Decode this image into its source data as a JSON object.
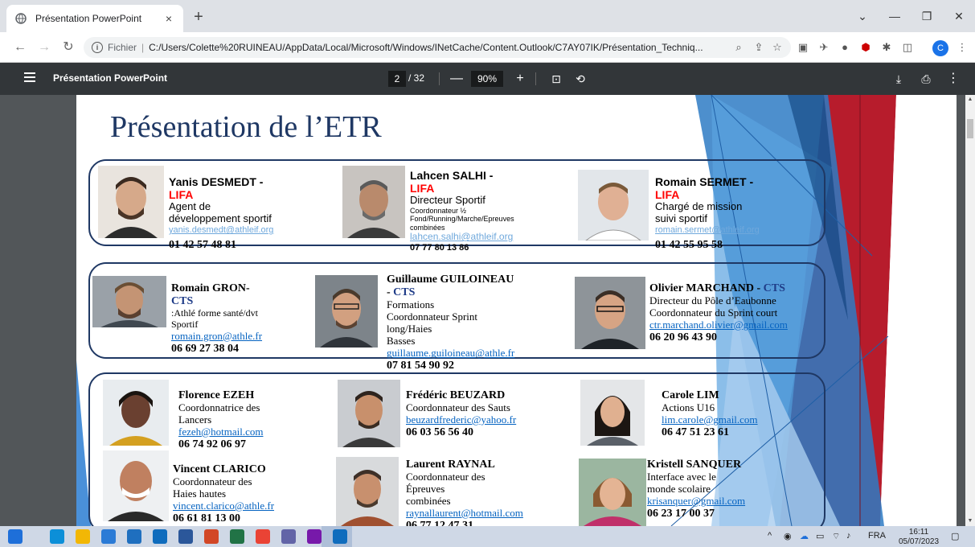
{
  "browser": {
    "tab_title": "Présentation PowerPoint",
    "tab_close": "×",
    "new_tab": "+",
    "scheme_label": "Fichier",
    "url": "C:/Users/Colette%20RUINEAU/AppData/Local/Microsoft/Windows/INetCache/Content.Outlook/C7AY07IK/Présentation_Techniq...",
    "profile_initial": "C"
  },
  "pdf_toolbar": {
    "title": "Présentation PowerPoint",
    "current_page": "2",
    "total_pages": "/ 32",
    "zoom": "90%"
  },
  "slide": {
    "title": "Présentation de l’ETR",
    "lifa_group": [
      {
        "name": "Yanis DESMEDT",
        "sep": " - ",
        "org": "LIFA",
        "role": "Agent de développement sportif",
        "email": "yanis.desmedt@athleif.org",
        "phone": "01 42 57 48 81"
      },
      {
        "name": "Lahcen SALHI",
        "sep": " - ",
        "org": "LIFA",
        "role": "Directeur Sportif",
        "role_line2": "Coordonnateur ½",
        "role_line3": "Fond/Running/Marche/Epreuves combinées",
        "email": "lahcen.salhi@athleif.org",
        "phone": "07 77 80 13 86"
      },
      {
        "name": "Romain SERMET",
        "sep": " - ",
        "org": "LIFA",
        "role": "Chargé de mission suivi sportif",
        "email": "romain.sermet@athleif.org",
        "phone": "01 42 55 95 58"
      }
    ],
    "cts_group": [
      {
        "name": "Romain GRON",
        "sep": "- ",
        "org": "CTS",
        "role": ":Athlé forme santé/dvt Sportif",
        "email": "romain.gron@athle.fr",
        "phone": "06 69 27 38 04"
      },
      {
        "name": "Guillaume GUILOINEAU",
        "sep": " - ",
        "org": "CTS",
        "role": "Formations",
        "role_line2": "Coordonnateur Sprint long/Haies",
        "role_line3": "Basses",
        "email": "guillaume.guiloineau@athle.fr",
        "phone": "07 81 54 90 92"
      },
      {
        "name": "Olivier MARCHAND",
        "sep": " - ",
        "org": "CTS",
        "role": "Directeur du Pôle d’Eaubonne",
        "role_line2": "Coordonnateur du Sprint court",
        "email": "ctr.marchand.olivier@gmail.com",
        "phone": "06 20 96 43 90"
      }
    ],
    "coord_group": [
      {
        "name": "Florence EZEH",
        "role": "Coordonnatrice des Lancers",
        "email": "fezeh@hotmail.com",
        "phone": "06 74 92 06 97"
      },
      {
        "name": "Frédéric BEUZARD",
        "role": "Coordonnateur des Sauts",
        "email": "beuzardfrederic@yahoo.fr",
        "phone": "06 03 56 56 40"
      },
      {
        "name": "Carole LIM",
        "role": "Actions U16",
        "email": "lim.carole@gmail.com",
        "phone": "06 47 51 23 61"
      },
      {
        "name": "Vincent CLARICO",
        "role": "Coordonnateur des Haies hautes",
        "email": "vincent.clarico@athle.fr",
        "phone": "06 61 81 13 00"
      },
      {
        "name": "Laurent RAYNAL",
        "role": "Coordonnateur des Épreuves",
        "role_line2": "combinées",
        "email": "raynallaurent@hotmail.com",
        "phone": "06 77 12 47 31"
      },
      {
        "name": "Kristell SANQUER",
        "role": "Interface avec le monde scolaire",
        "email": "krisanquer@gmail.com",
        "phone": "06 23 17 00 37"
      }
    ]
  },
  "taskbar": {
    "language": "FRA",
    "time": "16:11",
    "date": "05/07/2023",
    "apps": [
      {
        "icon": "windows-icon",
        "color": "#1e6fd9"
      },
      {
        "icon": "edge-icon",
        "color": "#0c8fd8"
      },
      {
        "icon": "file-explorer-icon",
        "color": "#f2b705"
      },
      {
        "icon": "store-icon",
        "color": "#2b7bd6"
      },
      {
        "icon": "media-icon",
        "color": "#1f6fbf"
      },
      {
        "icon": "outlook-icon",
        "color": "#0f6cbd"
      },
      {
        "icon": "word-icon",
        "color": "#2b579a"
      },
      {
        "icon": "powerpoint-icon",
        "color": "#d24726"
      },
      {
        "icon": "excel-icon",
        "color": "#217346"
      },
      {
        "icon": "chrome-icon",
        "color": "#ea4335"
      },
      {
        "icon": "teams-icon",
        "color": "#6264a7"
      },
      {
        "icon": "onenote-icon",
        "color": "#7719aa"
      },
      {
        "icon": "outlook-icon-2",
        "color": "#0f6cbd"
      }
    ]
  }
}
